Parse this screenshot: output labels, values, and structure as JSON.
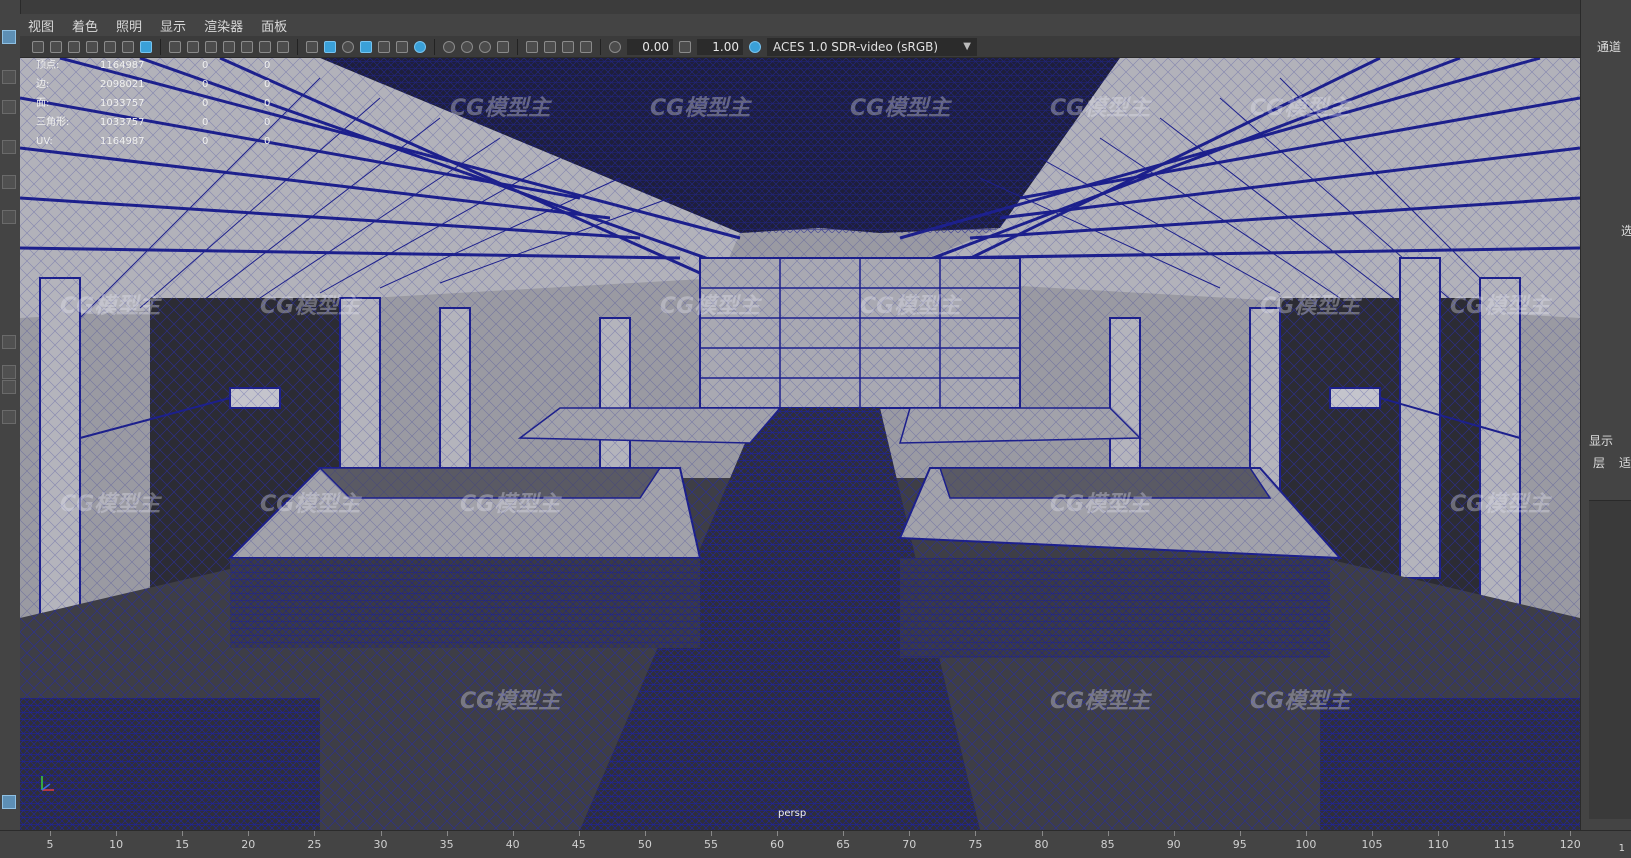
{
  "menu": {
    "items": [
      "视图",
      "着色",
      "照明",
      "显示",
      "渲染器",
      "面板"
    ]
  },
  "toolbar": {
    "exposure_value": "0.00",
    "gamma_value": "1.00",
    "color_space": "ACES 1.0 SDR-video (sRGB)"
  },
  "hud": {
    "rows": [
      {
        "label": "顶点:",
        "value": "1164987",
        "v2": "0",
        "v3": "0"
      },
      {
        "label": "边:",
        "value": "2098021",
        "v2": "0",
        "v3": "0"
      },
      {
        "label": "面:",
        "value": "1033757",
        "v2": "0",
        "v3": "0"
      },
      {
        "label": "三角形:",
        "value": "1033757",
        "v2": "0",
        "v3": "0"
      },
      {
        "label": "UV:",
        "value": "1164987",
        "v2": "0",
        "v3": "0"
      }
    ]
  },
  "viewport": {
    "camera_label": "persp",
    "watermark": "CG模型主"
  },
  "right_panel": {
    "channel_box": "通道",
    "select": "选",
    "display": "显示",
    "layer": "层",
    "extra": "适"
  },
  "timeline": {
    "ticks": [
      5,
      10,
      15,
      20,
      25,
      30,
      35,
      40,
      45,
      50,
      55,
      60,
      65,
      70,
      75,
      80,
      85,
      90,
      95,
      100,
      105,
      110,
      115,
      120
    ],
    "end_value": "1"
  }
}
